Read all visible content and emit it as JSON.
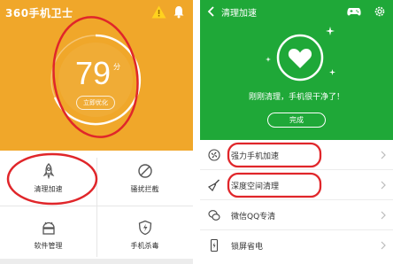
{
  "left_screen": {
    "app_logo": "360手机卫士",
    "score": "79",
    "score_unit": "分",
    "optimize_label": "立即优化",
    "tiles": [
      {
        "label": "清理加速",
        "icon": "rocket-icon"
      },
      {
        "label": "骚扰拦截",
        "icon": "block-icon"
      },
      {
        "label": "软件管理",
        "icon": "android-icon"
      },
      {
        "label": "手机杀毒",
        "icon": "shield-icon"
      }
    ]
  },
  "right_screen": {
    "title": "清理加速",
    "status_message": "刚刚清理，手机很干净了！",
    "done_label": "完成",
    "rows": [
      {
        "label": "强力手机加速",
        "icon": "fan-icon"
      },
      {
        "label": "深度空间清理",
        "icon": "broom-icon"
      },
      {
        "label": "微信QQ专清",
        "icon": "chat-icon"
      },
      {
        "label": "锁屏省电",
        "icon": "phone-battery-icon"
      }
    ]
  },
  "colors": {
    "left_accent": "#f0a72a",
    "right_accent": "#1fa838",
    "annotation_red": "#e0262a"
  }
}
